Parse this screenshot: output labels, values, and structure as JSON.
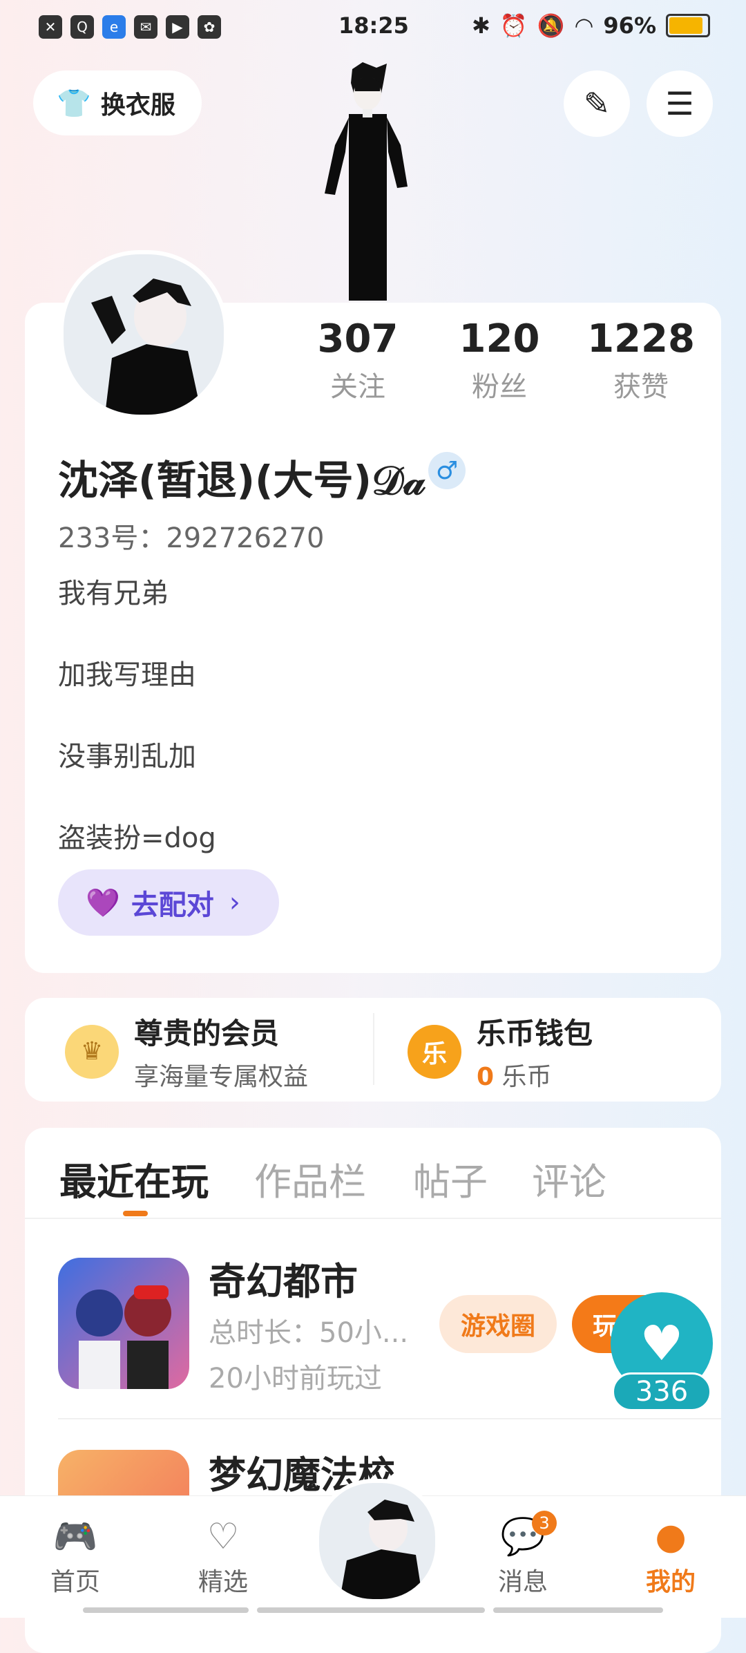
{
  "status_bar": {
    "time": "18:25",
    "battery": "96%"
  },
  "header": {
    "outfit_label": "换衣服"
  },
  "stats": [
    {
      "value": "307",
      "label": "关注"
    },
    {
      "value": "120",
      "label": "粉丝"
    },
    {
      "value": "1228",
      "label": "获赞"
    }
  ],
  "profile": {
    "nickname": "沈泽(暂退)(大号)𝒟𝒶",
    "gender": "♂",
    "id_line": "233号：292726270",
    "bio": [
      "我有兄弟",
      "加我写理由",
      "没事别乱加",
      "盗装扮=dog"
    ],
    "pair_label": "去配对"
  },
  "member": {
    "vip_title": "尊贵的会员",
    "vip_sub": "享海量专属权益",
    "wallet_title": "乐币钱包",
    "wallet_amount": "0",
    "wallet_unit": "乐币"
  },
  "tabs": [
    "最近在玩",
    "作品栏",
    "帖子",
    "评论"
  ],
  "games": [
    {
      "name": "奇幻都市",
      "duration": "总时长：50小...",
      "last_played": "20小时前玩过",
      "circle_label": "游戏圈",
      "play_label": "玩"
    },
    {
      "name": "梦幻魔法校"
    }
  ],
  "like_count": "336",
  "bottom_nav": [
    {
      "label": "首页"
    },
    {
      "label": "精选"
    },
    {
      "label": "消息",
      "badge": "3"
    },
    {
      "label": "我的"
    }
  ],
  "colors": {
    "accent": "#f07a1a",
    "like": "#20b4c4",
    "pair": "#5b47d6"
  }
}
